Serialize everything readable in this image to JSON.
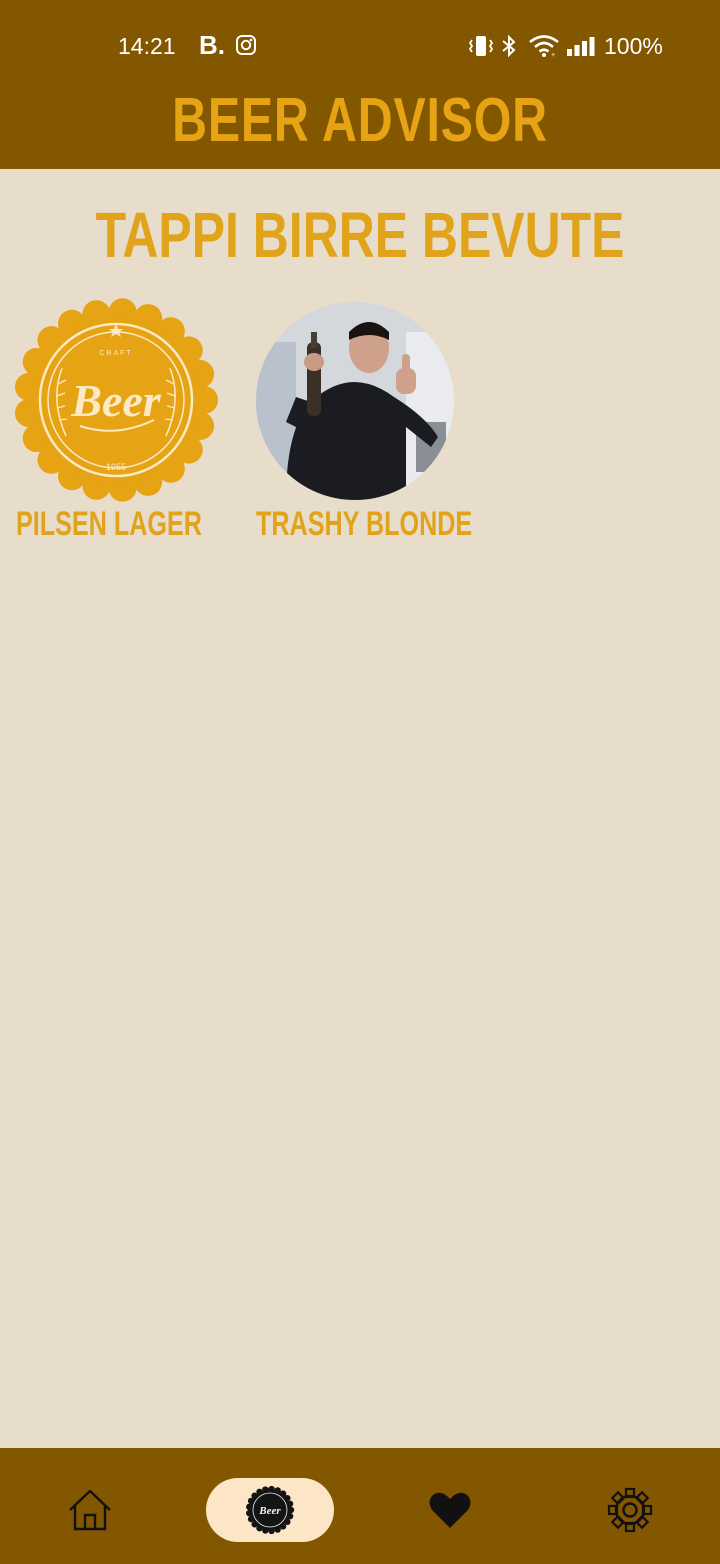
{
  "status_bar": {
    "time": "14:21",
    "app_icon_text": "B.",
    "battery": "100%",
    "icons": [
      "instagram-icon",
      "vibrate-icon",
      "bluetooth-icon",
      "wifi-icon",
      "signal-icon"
    ]
  },
  "header": {
    "title": "BEER ADVISOR"
  },
  "page": {
    "title": "TAPPI BIRRE BEVUTE"
  },
  "beers": [
    {
      "name": "PILSEN LAGER",
      "image": "beer-cap-icon",
      "cap_text_top": "CRAFT",
      "cap_text_main": "Beer",
      "cap_text_year": "1955"
    },
    {
      "name": "TRASHY BLONDE",
      "image": "user-photo"
    }
  ],
  "nav": {
    "items": [
      "home-icon",
      "bottle-cap-icon",
      "heart-icon",
      "gear-icon"
    ],
    "active": "bottle-cap-icon",
    "cap_text": "Beer"
  },
  "colors": {
    "brand_bar": "#835600",
    "accent": "#e0a31a",
    "background": "#e8dccb",
    "nav_active_pill": "#fde6c6"
  }
}
